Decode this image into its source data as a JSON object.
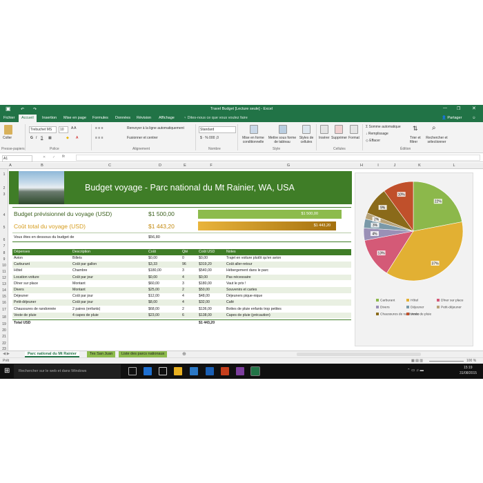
{
  "window": {
    "title": "Travel Budget [Lecture seule] - Excel"
  },
  "ribbon_tabs": [
    "Fichier",
    "Accueil",
    "Insertion",
    "Mise en page",
    "Formules",
    "Données",
    "Révision",
    "Affichage"
  ],
  "tell_me": "Dites-nous ce que vous voulez faire",
  "share": "Partager",
  "ribbon": {
    "paste": "Coller",
    "font_name": "Trebuchet MS",
    "font_size": "10",
    "wrap": "Renvoyer à la ligne automatiquement",
    "merge": "Fusionner et centrer",
    "number_format": "Standard",
    "cond_format": "Mise en forme conditionnelle",
    "format_table": "Mettre sous forme de tableau",
    "cell_styles": "Styles de cellules",
    "insert": "Insérer",
    "delete": "Supprimer",
    "format": "Format",
    "autosum": "Somme automatique",
    "fill": "Remplissage",
    "clear": "Effacer",
    "sort": "Trier et filtrer",
    "find": "Rechercher et sélectionner",
    "groups": {
      "clipboard": "Presse-papiers",
      "font": "Police",
      "alignment": "Alignement",
      "number": "Nombre",
      "style": "Style",
      "cells": "Cellules",
      "editing": "Édition"
    }
  },
  "name_box": "A1",
  "columns": [
    "A",
    "B",
    "C",
    "D",
    "E",
    "F",
    "G",
    "H",
    "I",
    "J",
    "K",
    "L"
  ],
  "rows": [
    "1",
    "2",
    "3",
    "4",
    "5",
    "6",
    "7",
    "8",
    "9",
    "10",
    "11",
    "12",
    "13",
    "14",
    "15",
    "16",
    "17",
    "18",
    "19",
    "20",
    "21",
    "22",
    "23"
  ],
  "sheet": {
    "title": "Budget voyage - Parc national du Mt Rainier, WA, USA",
    "planned_label": "Budget prévisionnel du voyage (USD)",
    "planned_value": "$1 500,00",
    "planned_bar": "$1 500,00",
    "total_label": "Coût total du voyage (USD)",
    "total_value": "$1 443,20",
    "total_bar": "$1 443,20",
    "under_label": "Vous êtes en dessous du budget de",
    "under_value": "$56,80",
    "headers": [
      "Dépenses",
      "Description",
      "Coût",
      "Qté",
      "Coût USD",
      "Notes"
    ],
    "items": [
      [
        "Avion",
        "Billets",
        "$0,00",
        "0",
        "$0,00",
        "Trajet en voiture plutôt qu'en avion"
      ],
      [
        "Carburant",
        "Coût par gallon",
        "$3,33",
        "96",
        "$319,20",
        "Coût aller-retour"
      ],
      [
        "Hôtel",
        "Chambre",
        "$180,00",
        "3",
        "$540,00",
        "Hébergement dans le parc"
      ],
      [
        "Location voiture",
        "Coût par jour",
        "$0,00",
        "4",
        "$0,00",
        "Pas nécessaire"
      ],
      [
        "Dîner sur place",
        "Montant",
        "$60,00",
        "3",
        "$180,00",
        "Vaut le prix !"
      ],
      [
        "Divers",
        "Montant",
        "$25,00",
        "2",
        "$50,00",
        "Souvenirs et cartes"
      ],
      [
        "Déjeuner",
        "Coût par jour",
        "$12,00",
        "4",
        "$48,00",
        "Déjeuners pique-nique"
      ],
      [
        "Petit-déjeuner",
        "Coût par jour",
        "$8,00",
        "4",
        "$32,00",
        "Café"
      ],
      [
        "Chaussures de randonnée",
        "2 paires (enfants)",
        "$68,00",
        "2",
        "$136,00",
        "Bottes de pluie enfants trop petites"
      ],
      [
        "Veste de pluie",
        "4 capes de pluie",
        "$23,00",
        "6",
        "$138,00",
        "Capes de pluie (précaution)"
      ]
    ],
    "total_row": {
      "label": "Total USD",
      "value": "$1 443,20"
    },
    "bars": {
      "planned_fraction": 1.0,
      "total_fraction": 0.962
    }
  },
  "chart_data": {
    "type": "pie",
    "categories": [
      "Carburant",
      "Hôtel",
      "Dîner sur place",
      "Divers",
      "Déjeuner",
      "Petit-déjeuner",
      "Chaussures de randonnée",
      "Veste de pluie",
      "Avion",
      "Location voiture"
    ],
    "values": [
      22,
      37,
      13,
      4,
      3,
      2,
      9,
      10,
      0,
      0
    ],
    "value_labels": [
      "22%",
      "37%",
      "13%",
      "4%",
      "3%",
      "2%",
      "9%",
      "10%",
      "",
      ""
    ],
    "colors": [
      "#8cb84b",
      "#e2b033",
      "#d45a77",
      "#9a90b6",
      "#7a99a8",
      "#b7a37a",
      "#8a6a1a",
      "#c0502b",
      "#6b8e3a",
      "#4f7ea8"
    ],
    "legend": [
      "Carburant",
      "Hôtel",
      "Dîner sur place",
      "Divers",
      "Déjeuner",
      "Petit-déjeuner",
      "Chaussures de randonnée",
      "Veste de pluie"
    ],
    "legend_position": "bottom"
  },
  "sheet_tabs": [
    "Parc national du Mt Rainier",
    "Tes San Juan",
    "Liste des parcs nationaux"
  ],
  "status": {
    "left": "Prêt",
    "zoom": "100 %"
  },
  "taskbar": {
    "search": "Rechercher sur le web et dans Windows",
    "time": "15:19",
    "date": "31/08/2015"
  }
}
